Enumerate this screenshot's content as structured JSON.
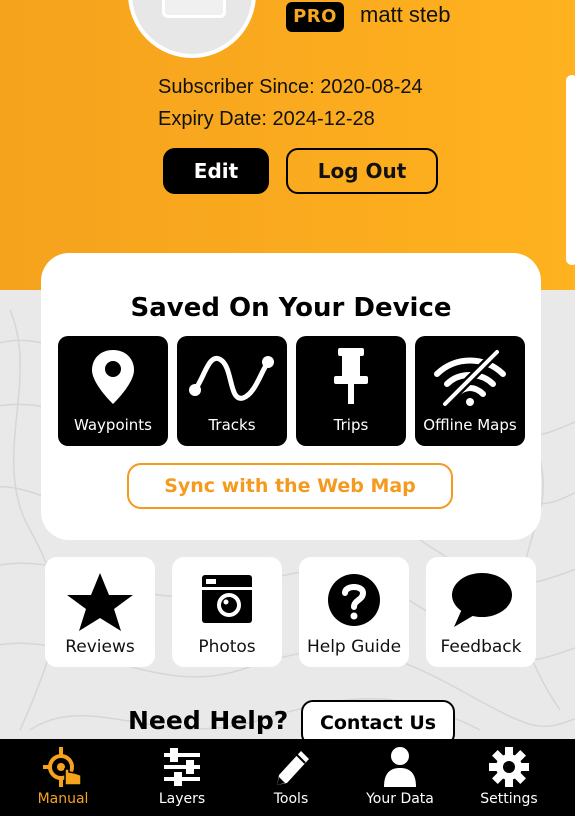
{
  "profile": {
    "badge": "PRO",
    "username": "matt steb",
    "subscriber_since": "Subscriber Since: 2020-08-24",
    "expiry_date": "Expiry Date: 2024-12-28",
    "edit_label": "Edit",
    "logout_label": "Log Out"
  },
  "saved": {
    "title": "Saved On Your Device",
    "tiles": [
      {
        "label": "Waypoints",
        "icon": "map-pin-icon"
      },
      {
        "label": "Tracks",
        "icon": "track-line-icon"
      },
      {
        "label": "Trips",
        "icon": "pushpin-icon"
      },
      {
        "label": "Offline Maps",
        "icon": "wifi-off-icon"
      }
    ],
    "sync_label": "Sync with the Web Map"
  },
  "cards": [
    {
      "label": "Reviews",
      "icon": "star-icon"
    },
    {
      "label": "Photos",
      "icon": "camera-icon"
    },
    {
      "label": "Help Guide",
      "icon": "help-icon"
    },
    {
      "label": "Feedback",
      "icon": "speech-bubble-icon"
    }
  ],
  "help": {
    "title": "Need Help?",
    "contact_label": "Contact Us"
  },
  "nav": [
    {
      "label": "Manual",
      "icon": "crosshair-hand-icon",
      "active": true
    },
    {
      "label": "Layers",
      "icon": "sliders-icon",
      "active": false
    },
    {
      "label": "Tools",
      "icon": "pencil-icon",
      "active": false
    },
    {
      "label": "Your Data",
      "icon": "person-icon",
      "active": false
    },
    {
      "label": "Settings",
      "icon": "gear-icon",
      "active": false
    }
  ],
  "colors": {
    "accent": "#f5a21d",
    "header_bg": "#ffb21f",
    "dark": "#000000",
    "card_bg": "#ffffff",
    "page_bg": "#e9e9e9"
  }
}
